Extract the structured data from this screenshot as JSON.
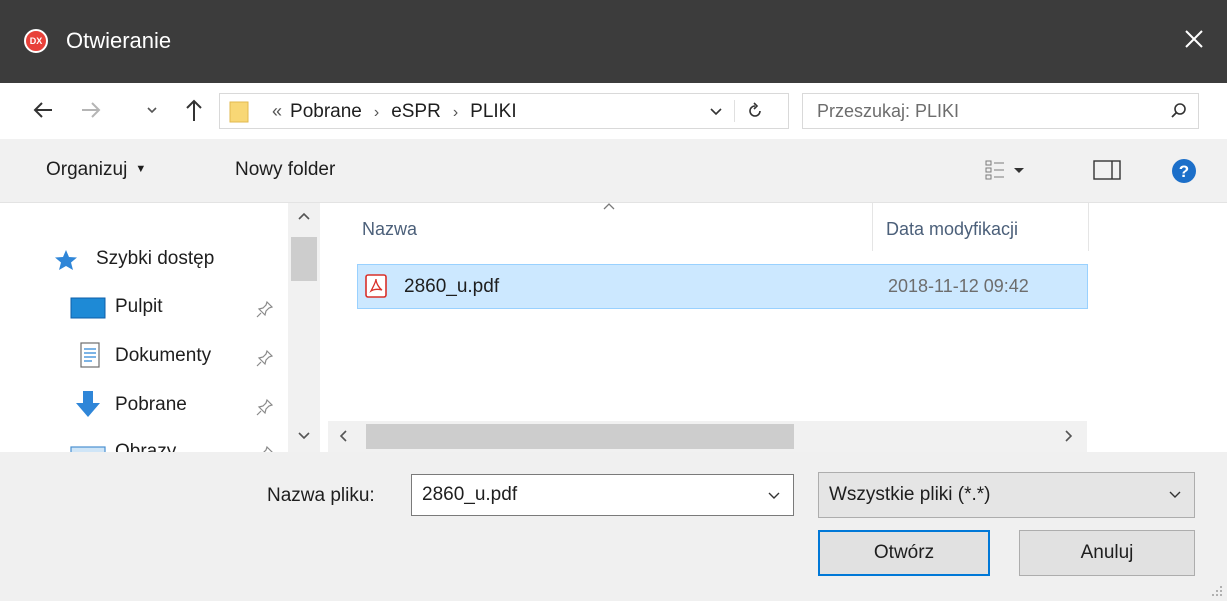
{
  "window": {
    "title": "Otwieranie",
    "app_icon_text": "DX"
  },
  "address": {
    "overflow": "«",
    "crumbs": [
      "Pobrane",
      "eSPR",
      "PLIKI"
    ],
    "separator": "›"
  },
  "search": {
    "placeholder": "Przeszukaj: PLIKI"
  },
  "toolbar": {
    "organize_label": "Organizuj",
    "new_folder_label": "Nowy folder"
  },
  "navpane": {
    "quick_access": "Szybki dostęp",
    "items": [
      {
        "label": "Pulpit",
        "icon": "desktop-icon"
      },
      {
        "label": "Dokumenty",
        "icon": "documents-icon"
      },
      {
        "label": "Pobrane",
        "icon": "downloads-icon"
      },
      {
        "label": "Obrazy",
        "icon": "pictures-icon"
      }
    ]
  },
  "filelist": {
    "columns": [
      "Nazwa",
      "Data modyfikacji"
    ],
    "files": [
      {
        "name": "2860_u.pdf",
        "modified": "2018-11-12 09:42",
        "selected": true
      }
    ]
  },
  "footer": {
    "filename_label": "Nazwa pliku:",
    "filename_value": "2860_u.pdf",
    "filetype_value": "Wszystkie pliki (*.*)",
    "open_label": "Otwórz",
    "cancel_label": "Anuluj"
  },
  "colors": {
    "titlebar": "#3c3c3c",
    "selection": "#cce8ff",
    "accent": "#0078d7",
    "help": "#1c6fc9"
  }
}
